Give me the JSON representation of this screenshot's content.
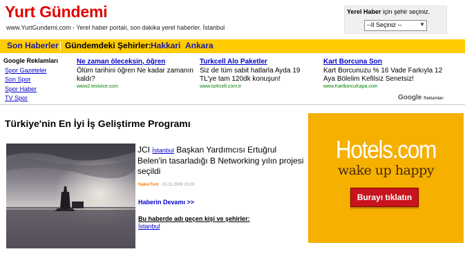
{
  "header": {
    "site_title": "Yurt Gündemi",
    "tagline": "www.YurtGundemi.com - Yerel haber portalı, son dakika yerel haberler. İstanbul",
    "city_box": {
      "label_bold_1": "Yerel",
      "label_bold_2": "Haber",
      "label_rest": "için şehir seçiniz.",
      "select_value": "--Il Seçiniz --"
    }
  },
  "nav": {
    "son_haberler": "Son Haberler",
    "gundem_label": "Gündemdeki Şehirler:",
    "cities": [
      "Hakkari",
      "Ankara"
    ]
  },
  "ads": {
    "left_title": "Google Reklamları",
    "left_links": [
      "Spor Gazeteler",
      "Son Spor",
      "Spor Haber",
      "TV Spor"
    ],
    "units": [
      {
        "title": "Ne zaman öleceksin, öğren",
        "text": "Ölüm tarihini öğren Ne kadar zamanın kaldı?",
        "url": "www2.testvice.com"
      },
      {
        "title": "Turkcell Alo Paketler",
        "text": "Siz de tüm sabit hatlarla Ayda 19 TL'ye tam 120dk konuşun!",
        "url": "www.turkcell.com.tr"
      },
      {
        "title": "Kart Borcuna Son",
        "text": "Kart Borcunuzu % 16 Vade Farkıyla 12 Aya Bölelim Kefilsiz Senetsiz!",
        "url": "www.KartborcuKapa.com"
      }
    ],
    "google_label_brand": "Google",
    "google_label_text": "Reklamları"
  },
  "news": {
    "headline": "Türkiye'nin En İyi İş Geliştirme Programı",
    "text_before": "JCI",
    "location": "İstanbul",
    "text_after": "Başkan Yardımcısı Ertuğrul Belen'in tasarladığı B Networking yılın projesi seçildi",
    "source": "HaberTurk",
    "date": "- 15.11.2009 15:00",
    "read_more": "Haberin Devamı >>",
    "related_title": "Bu haberde adı geçen kişi ve şehirler:",
    "related_link": "İstanbul"
  },
  "banner": {
    "brand": "Hotels.com",
    "slogan": "wake up happy",
    "button": "Burayı tıklatın",
    "colors": {
      "background": "#f5b000",
      "button": "#c8141e"
    }
  }
}
